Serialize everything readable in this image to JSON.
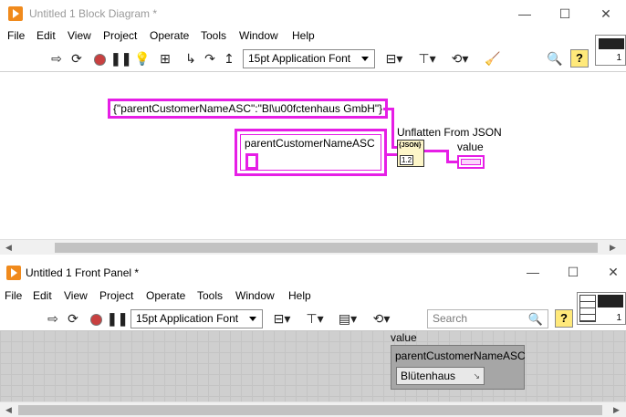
{
  "block_diagram": {
    "title": "Untitled 1 Block Diagram *",
    "window_controls": {
      "minimize": "—",
      "maximize": "☐",
      "close": "✕"
    },
    "menu": [
      "File",
      "Edit",
      "View",
      "Project",
      "Operate",
      "Tools",
      "Window",
      "Help"
    ],
    "toolbar": {
      "font": "15pt Application Font"
    },
    "json_constant": "{\"parentCustomerNameASC\":\"Bl\\u00fctenhaus GmbH\"}",
    "cluster_constant_label": "parentCustomerNameASC",
    "node_label": "Unflatten From JSON",
    "node_glyph": "{JSON}",
    "node_glyph_bottom": "1.2",
    "indicator_label": "value",
    "icon_number": "1"
  },
  "front_panel": {
    "title": "Untitled 1 Front Panel *",
    "window_controls": {
      "minimize": "—",
      "maximize": "☐",
      "close": "✕"
    },
    "menu": [
      "File",
      "Edit",
      "View",
      "Project",
      "Operate",
      "Tools",
      "Window",
      "Help"
    ],
    "toolbar": {
      "font": "15pt Application Font",
      "search_placeholder": "Search"
    },
    "cluster_label": "value",
    "element_label": "parentCustomerNameASC",
    "element_value": "Blütenhaus",
    "icon_number": "1"
  }
}
